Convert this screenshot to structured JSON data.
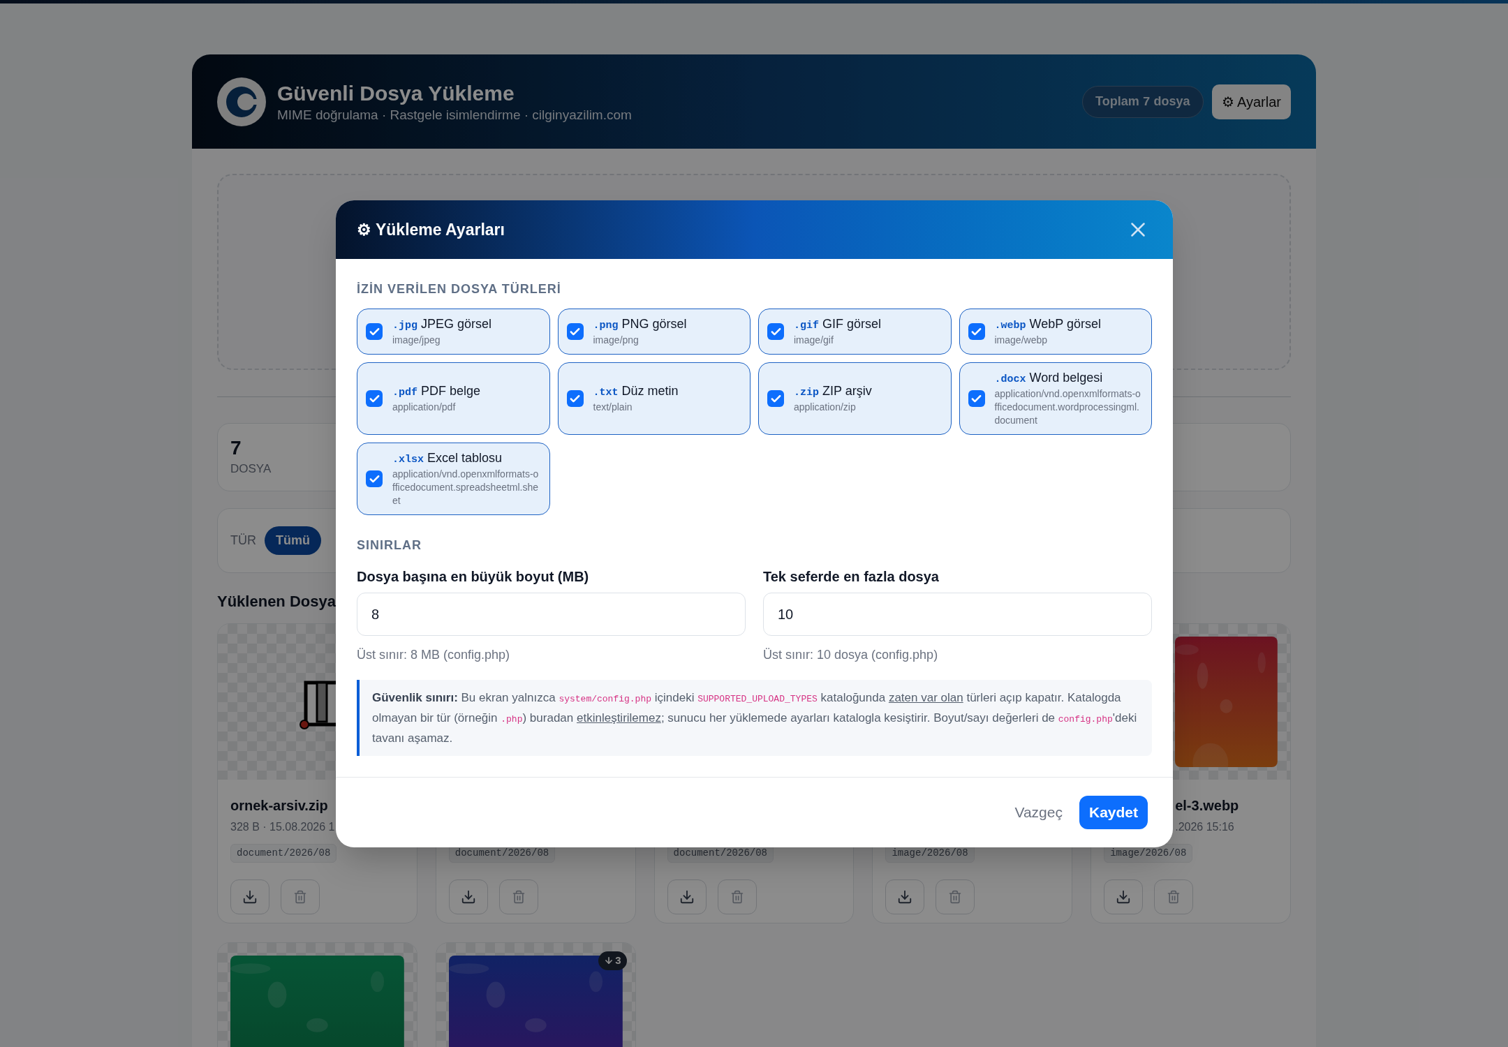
{
  "app": {
    "title": "Güvenli Dosya Yükleme",
    "subtitle": "MIME doğrulama · Rastgele isimlendirme · cilginyazilim.com",
    "total_badge": {
      "prefix": "Toplam",
      "count": "7",
      "suffix": "dosya"
    },
    "settings_button": "⚙ Ayarlar"
  },
  "stats": [
    {
      "value": "7",
      "label": "DOSYA"
    }
  ],
  "filter": {
    "label": "TÜR",
    "options": [
      {
        "label": "Tümü",
        "selected": true
      }
    ]
  },
  "files_heading": "Yüklenen Dosya",
  "files": [
    {
      "kind": "archive",
      "name": "ornek-arsiv.zip",
      "meta": "328 B · 15.08.2026 1",
      "folder": "document/2026/08"
    },
    {
      "folder": "document/2026/08"
    },
    {
      "folder": "document/2026/08"
    },
    {
      "folder": "image/2026/08"
    },
    {
      "kind": "picture",
      "name": "el-3.webp",
      "meta": ".2026 15:16",
      "folder": "image/2026/08"
    },
    {
      "kind": "picture"
    },
    {
      "kind": "picture",
      "badge": "3"
    }
  ],
  "modal": {
    "title": "⚙ Yükleme Ayarları",
    "types_heading": "İZİN VERİLEN DOSYA TÜRLERİ",
    "types": [
      {
        "ext": ".jpg",
        "label": "JPEG görsel",
        "mime": "image/jpeg",
        "checked": true
      },
      {
        "ext": ".png",
        "label": "PNG görsel",
        "mime": "image/png",
        "checked": true
      },
      {
        "ext": ".gif",
        "label": "GIF görsel",
        "mime": "image/gif",
        "checked": true
      },
      {
        "ext": ".webp",
        "label": "WebP görsel",
        "mime": "image/webp",
        "checked": true
      },
      {
        "ext": ".pdf",
        "label": "PDF belge",
        "mime": "application/pdf",
        "checked": true
      },
      {
        "ext": ".txt",
        "label": "Düz metin",
        "mime": "text/plain",
        "checked": true
      },
      {
        "ext": ".zip",
        "label": "ZIP arşiv",
        "mime": "application/zip",
        "checked": true
      },
      {
        "ext": ".docx",
        "label": "Word belgesi",
        "mime": "application/vnd.openxmlformats-officedocument.wordprocessingml.document",
        "checked": true
      },
      {
        "ext": ".xlsx",
        "label": "Excel tablosu",
        "mime": "application/vnd.openxmlformats-officedocument.spreadsheetml.sheet",
        "checked": true
      }
    ],
    "limits_heading": "SINIRLAR",
    "fields": [
      {
        "label": "Dosya başına en büyük boyut (MB)",
        "value": "8",
        "help": "Üst sınır: 8 MB (config.php)"
      },
      {
        "label": "Tek seferde en fazla dosya",
        "value": "10",
        "help": "Üst sınır: 10 dosya (config.php)"
      }
    ],
    "note": [
      {
        "kind": "bold",
        "text": "Güvenlik sınırı:"
      },
      {
        "kind": "text",
        "text": " Bu ekran yalnızca "
      },
      {
        "kind": "code",
        "text": "system/config.php"
      },
      {
        "kind": "text",
        "text": " içindeki "
      },
      {
        "kind": "code",
        "text": "SUPPORTED_UPLOAD_TYPES"
      },
      {
        "kind": "text",
        "text": " kataloğunda "
      },
      {
        "kind": "link",
        "text": "zaten var olan"
      },
      {
        "kind": "text",
        "text": " türleri açıp kapatır. Katalogda olmayan bir tür (örneğin "
      },
      {
        "kind": "code",
        "text": ".php"
      },
      {
        "kind": "text",
        "text": ") buradan "
      },
      {
        "kind": "link",
        "text": "etkinleştirilemez"
      },
      {
        "kind": "text",
        "text": "; sunucu her yüklemede ayarları katalogla kesiştirir. Boyut/sayı değerleri de "
      },
      {
        "kind": "code",
        "text": "config.php"
      },
      {
        "kind": "text",
        "text": "'deki tavanı aşamaz."
      }
    ],
    "cancel": "Vazgeç",
    "save": "Kaydet"
  }
}
